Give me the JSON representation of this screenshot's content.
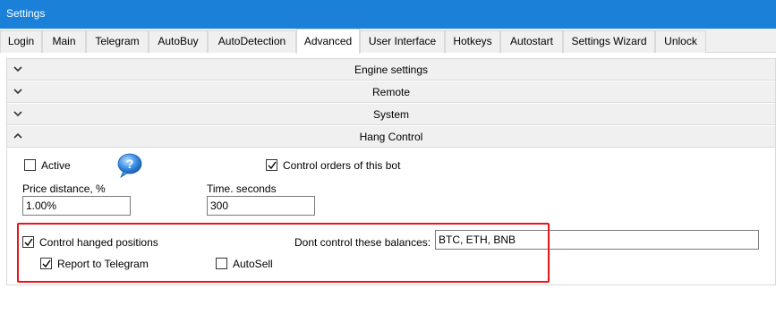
{
  "window": {
    "title": "Settings"
  },
  "tabs": [
    {
      "label": "Login",
      "active": false
    },
    {
      "label": "Main",
      "active": false
    },
    {
      "label": "Telegram",
      "active": false
    },
    {
      "label": "AutoBuy",
      "active": false
    },
    {
      "label": "AutoDetection",
      "active": false
    },
    {
      "label": "Advanced",
      "active": true
    },
    {
      "label": "User Interface",
      "active": false
    },
    {
      "label": "Hotkeys",
      "active": false
    },
    {
      "label": "Autostart",
      "active": false
    },
    {
      "label": "Settings Wizard",
      "active": false
    },
    {
      "label": "Unlock",
      "active": false
    }
  ],
  "sections": [
    {
      "label": "Engine settings",
      "expanded": false
    },
    {
      "label": "Remote",
      "expanded": false
    },
    {
      "label": "System",
      "expanded": false
    },
    {
      "label": "Hang Control",
      "expanded": true
    }
  ],
  "hang_control": {
    "active": {
      "label": "Active",
      "checked": false
    },
    "control_orders": {
      "label": "Control orders of this bot",
      "checked": true
    },
    "price_distance": {
      "label": "Price distance, %",
      "value": "1.00%"
    },
    "time_seconds": {
      "label": "Time. seconds",
      "value": "300"
    },
    "control_hanged": {
      "label": "Control hanged positions",
      "checked": true
    },
    "report_telegram": {
      "label": "Report to Telegram",
      "checked": true
    },
    "autosell": {
      "label": "AutoSell",
      "checked": false
    },
    "dont_control": {
      "label": "Dont control these balances:",
      "value": "BTC, ETH, BNB"
    }
  },
  "colors": {
    "titlebar": "#1a80d8",
    "highlight_box": "#e8161b",
    "help_icon": "#3a8ee6"
  },
  "icons": {
    "help": "help-speech-bubble-icon",
    "check": "checkmark-icon",
    "collapsed": "chevron-down-icon",
    "expanded": "chevron-up-icon"
  }
}
